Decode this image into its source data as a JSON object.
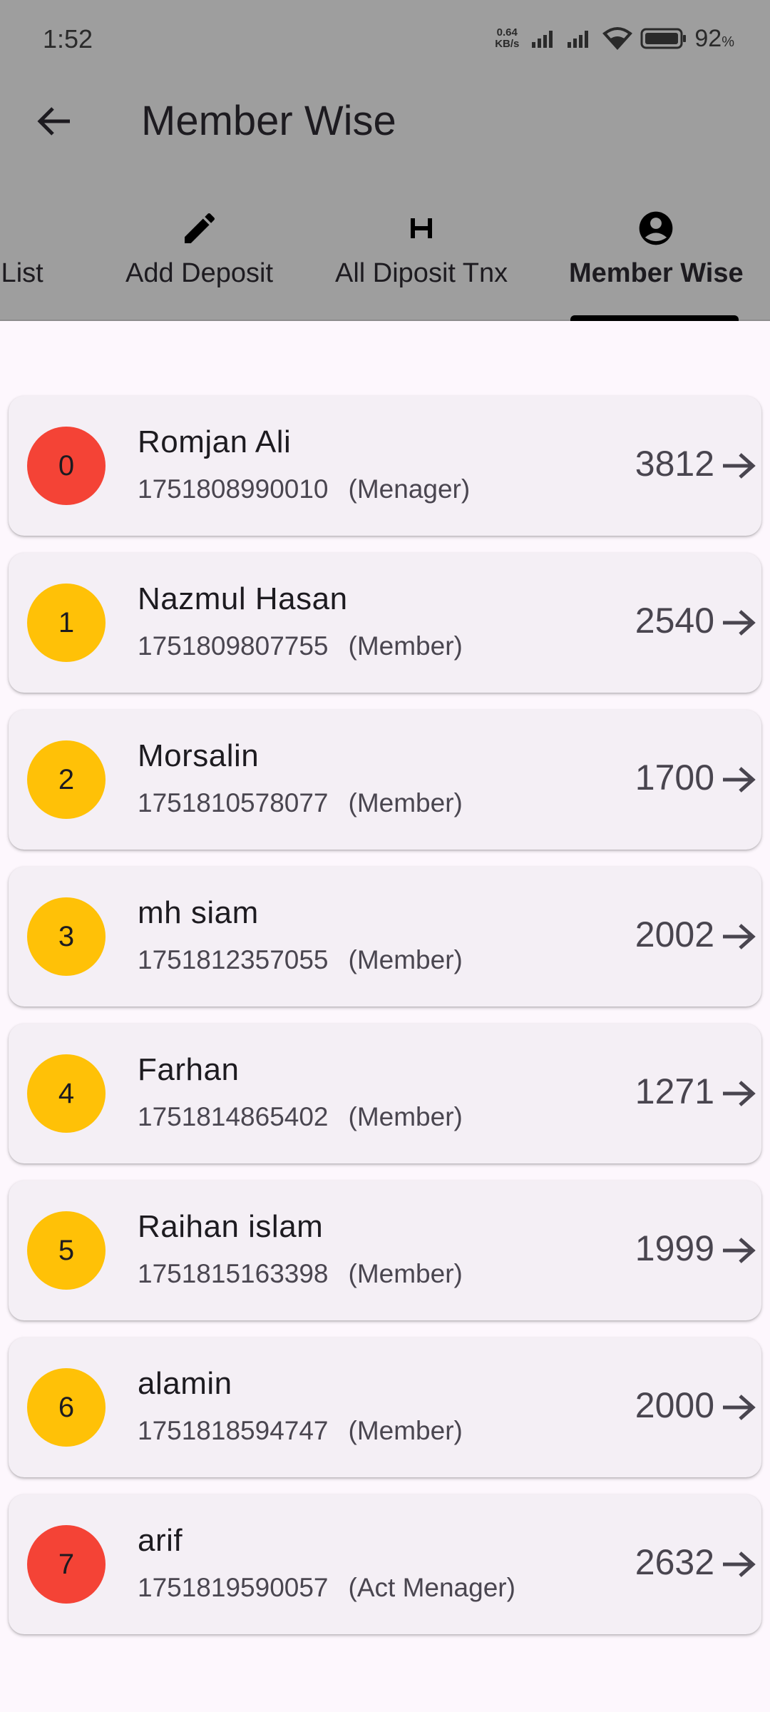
{
  "status_bar": {
    "time": "1:52",
    "net_speed_top": "0.64",
    "net_speed_bottom": "KB/s",
    "battery_pct": "92",
    "battery_unit": "%"
  },
  "header": {
    "title": "Member Wise"
  },
  "tabs": [
    {
      "label": "it List",
      "icon": "none",
      "active": false
    },
    {
      "label": "Add Deposit",
      "icon": "pencil-icon",
      "active": false
    },
    {
      "label": "All Diposit Tnx",
      "icon": "letter-h-icon",
      "active": false
    },
    {
      "label": "Member Wise",
      "icon": "account-circle-icon",
      "active": true
    }
  ],
  "colors": {
    "appbar": "#9e9e9e",
    "badge_red": "#f44336",
    "badge_amber": "#ffc107",
    "card": "#f4eff5",
    "background": "#fdf7fd"
  },
  "members": [
    {
      "index": "0",
      "name": "Romjan Ali",
      "phone": "1751808990010",
      "role": "(Menager)",
      "amount": "3812",
      "badge_color": "#f44336"
    },
    {
      "index": "1",
      "name": "Nazmul Hasan",
      "phone": "1751809807755",
      "role": "(Member)",
      "amount": "2540",
      "badge_color": "#ffc107"
    },
    {
      "index": "2",
      "name": "Morsalin",
      "phone": "1751810578077",
      "role": "(Member)",
      "amount": "1700",
      "badge_color": "#ffc107"
    },
    {
      "index": "3",
      "name": "mh siam",
      "phone": "1751812357055",
      "role": "(Member)",
      "amount": "2002",
      "badge_color": "#ffc107"
    },
    {
      "index": "4",
      "name": "Farhan",
      "phone": "1751814865402",
      "role": "(Member)",
      "amount": "1271",
      "badge_color": "#ffc107"
    },
    {
      "index": "5",
      "name": "Raihan islam",
      "phone": "1751815163398",
      "role": "(Member)",
      "amount": "1999",
      "badge_color": "#ffc107"
    },
    {
      "index": "6",
      "name": "alamin",
      "phone": "1751818594747",
      "role": "(Member)",
      "amount": "2000",
      "badge_color": "#ffc107"
    },
    {
      "index": "7",
      "name": "arif",
      "phone": "1751819590057",
      "role": "(Act Menager)",
      "amount": "2632",
      "badge_color": "#f44336"
    }
  ]
}
